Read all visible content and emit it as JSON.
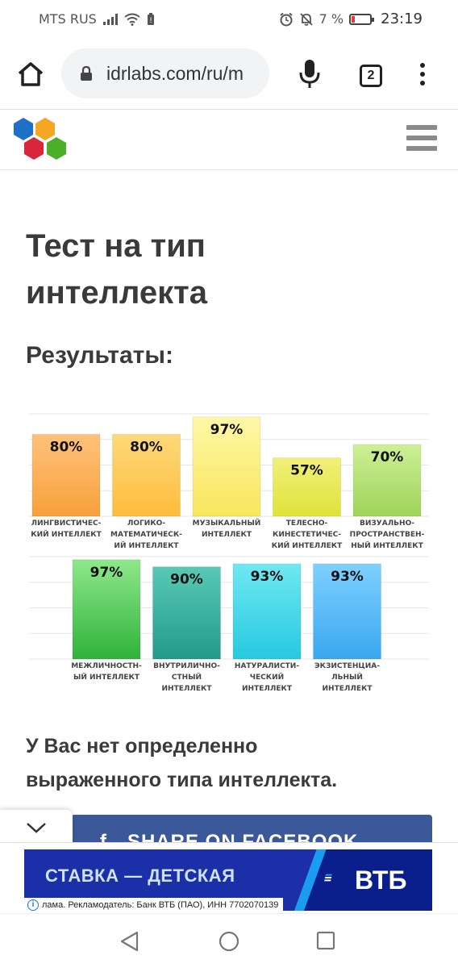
{
  "status_bar": {
    "carrier": "MTS RUS",
    "battery_percent": "7 %",
    "time": "23:19"
  },
  "browser": {
    "url": "idrlabs.com/ru/m",
    "tab_count": "2",
    "icons": [
      "home-icon",
      "lock-icon",
      "mic-icon",
      "tabs-icon",
      "menu-icon"
    ]
  },
  "site": {
    "menu_icon": "hamburger-icon"
  },
  "page": {
    "title_line1": "Тест на тип",
    "title_line2": "интеллекта",
    "results_heading": "Результаты:",
    "summary_line1": "У Вас нет определенно",
    "summary_line2": "выраженного типа интеллекта."
  },
  "chart_data": {
    "type": "bar",
    "ylim": [
      0,
      100
    ],
    "grid": true,
    "rows": [
      {
        "bars": [
          {
            "label": [
              "ЛИНГВИСТИЧЕС-",
              "КИЙ ИНТЕЛЛЕКТ"
            ],
            "value": 80,
            "color_top": "#ffc27a",
            "color_bottom": "#f7a03c"
          },
          {
            "label": [
              "ЛОГИКО-",
              "МАТЕМАТИЧЕСК-",
              "ИЙ ИНТЕЛЛЕКТ"
            ],
            "value": 80,
            "color_top": "#ffd97a",
            "color_bottom": "#fdbc3c"
          },
          {
            "label": [
              "МУЗЫКАЛЬНЫЙ",
              "ИНТЕЛЛЕКТ"
            ],
            "value": 97,
            "color_top": "#fff7a8",
            "color_bottom": "#f8e65c"
          },
          {
            "label": [
              "ТЕЛЕСНО-",
              "КИНЕСТЕТИЧЕС-",
              "КИЙ ИНТЕЛЛЕКТ"
            ],
            "value": 57,
            "color_top": "#f0f07a",
            "color_bottom": "#dfe33a"
          },
          {
            "label": [
              "ВИЗУАЛЬНО-",
              "ПРОСТРАНСТВЕН-",
              "НЫЙ ИНТЕЛЛЕКТ"
            ],
            "value": 70,
            "color_top": "#cdf096",
            "color_bottom": "#9fd35a"
          }
        ]
      },
      {
        "bars": [
          {
            "label": [
              "МЕЖЛИЧНОСТН-",
              "ЫЙ ИНТЕЛЛЕКТ"
            ],
            "value": 97,
            "color_top": "#8fe88a",
            "color_bottom": "#2fb23c"
          },
          {
            "label": [
              "ВНУТРИЛИЧНО-",
              "СТНЫЙ",
              "ИНТЕЛЛЕКТ"
            ],
            "value": 90,
            "color_top": "#58c9b6",
            "color_bottom": "#229a8c"
          },
          {
            "label": [
              "НАТУРАЛИСТИ-",
              "ЧЕСКИЙ",
              "ИНТЕЛЛЕКТ"
            ],
            "value": 93,
            "color_top": "#6fe8f2",
            "color_bottom": "#27c9e0"
          },
          {
            "label": [
              "ЭКЗИСТЕНЦИА-",
              "ЛЬНЫЙ",
              "ИНТЕЛЛЕКТ"
            ],
            "value": 93,
            "color_top": "#7fd0ff",
            "color_bottom": "#3aa7ef"
          }
        ]
      }
    ]
  },
  "share": {
    "facebook_glyph": "f",
    "label": "SHARE ON FACEBOOK"
  },
  "ad": {
    "headline": "СТАВКА — ДЕТСКАЯ",
    "brand": "ВТБ",
    "disclaimer": "лама. Рекламодатель: Банк ВТБ (ПАО), ИНН 7702070139",
    "info_glyph": "i",
    "colors": {
      "background": "#1a2fa8",
      "accent": "#1a9cf0"
    }
  },
  "nav_bar": {
    "icons": [
      "back-icon",
      "home-circle-icon",
      "recents-icon"
    ]
  }
}
